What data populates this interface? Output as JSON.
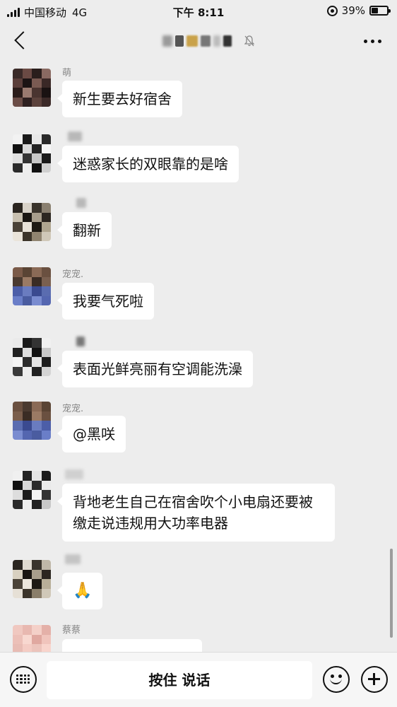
{
  "status_bar": {
    "carrier": "中国移动",
    "network": "4G",
    "time": "下午 8:11",
    "battery": "39%",
    "battery_level": 0.39
  },
  "nav": {
    "title_visible": "",
    "muted": true
  },
  "messages": [
    {
      "sender": "萌",
      "sender_blurred": false,
      "text": "新生要去好宿舍"
    },
    {
      "sender": "",
      "sender_blurred": true,
      "text": "迷惑家长的双眼靠的是啥"
    },
    {
      "sender": "",
      "sender_blurred": true,
      "text": "翻新"
    },
    {
      "sender": "宠宠.",
      "sender_blurred": false,
      "text": "我要气死啦"
    },
    {
      "sender": "",
      "sender_blurred": true,
      "text": "表面光鲜亮丽有空调能洗澡"
    },
    {
      "sender": "宠宠.",
      "sender_blurred": false,
      "text": "@黑咲"
    },
    {
      "sender": "",
      "sender_blurred": true,
      "text": "背地老生自己在宿舍吹个小电扇还要被缴走说违规用大功率电器"
    },
    {
      "sender": "",
      "sender_blurred": true,
      "text": "🙏"
    },
    {
      "sender": "蔡蔡",
      "sender_blurred": false,
      "text": ""
    }
  ],
  "input_bar": {
    "hold_to_talk": "按住 说话"
  },
  "colors": {
    "background": "#ededed",
    "bubble": "#ffffff",
    "sender_name": "#888888"
  },
  "icons": [
    "back-icon",
    "mute-icon",
    "more-icon",
    "keyboard-icon",
    "emoji-icon",
    "plus-icon"
  ]
}
